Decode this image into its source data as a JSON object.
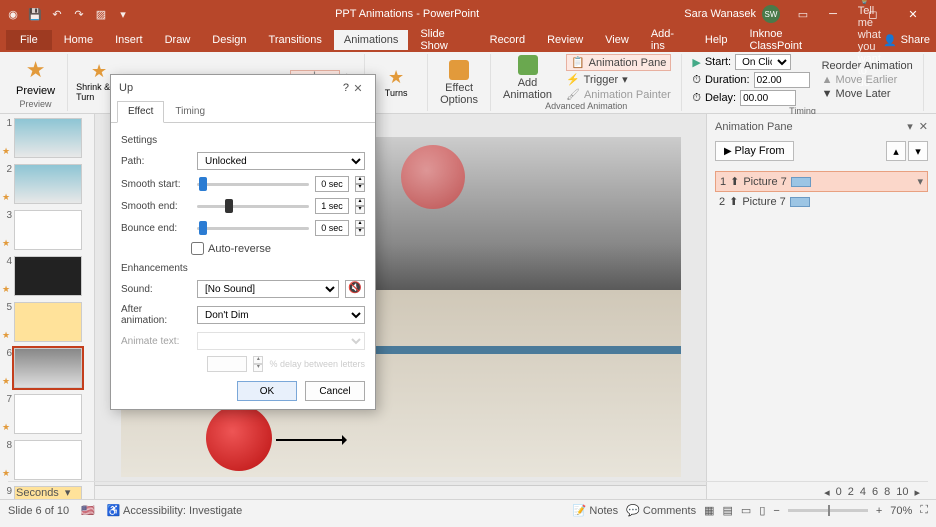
{
  "titlebar": {
    "doc_title": "PPT Animations - PowerPoint",
    "user_name": "Sara Wanasek",
    "user_initials": "SW"
  },
  "ribbon_tabs": {
    "file": "File",
    "home": "Home",
    "insert": "Insert",
    "draw": "Draw",
    "design": "Design",
    "transitions": "Transitions",
    "animations": "Animations",
    "slideshow": "Slide Show",
    "record": "Record",
    "review": "Review",
    "view": "View",
    "addins": "Add-ins",
    "help": "Help",
    "inknoe": "Inknoe ClassPoint",
    "tellme": "Tell me what you want to do",
    "share": "Share"
  },
  "ribbon": {
    "preview": "Preview",
    "preview_group": "Preview",
    "gallery": {
      "shrink_turn": "Shrink & Turn",
      "turns": "Turns"
    },
    "effect_options": "Effect\nOptions",
    "add_animation": "Add\nAnimation",
    "anim_pane_btn": "Animation Pane",
    "trigger": "Trigger",
    "anim_painter": "Animation Painter",
    "adv_group": "Advanced Animation",
    "start_label": "Start:",
    "start_value": "On Click",
    "duration_label": "Duration:",
    "duration_value": "02.00",
    "delay_label": "Delay:",
    "delay_value": "00.00",
    "timing_group": "Timing",
    "reorder": "Reorder Animation",
    "move_earlier": "Move Earlier",
    "move_later": "Move Later"
  },
  "dialog": {
    "title": "Up",
    "tab_effect": "Effect",
    "tab_timing": "Timing",
    "sec_settings": "Settings",
    "path_label": "Path:",
    "path_value": "Unlocked",
    "smooth_start_label": "Smooth start:",
    "smooth_start_value": "0 sec",
    "smooth_end_label": "Smooth end:",
    "smooth_end_value": "1 sec",
    "bounce_end_label": "Bounce end:",
    "bounce_end_value": "0 sec",
    "auto_reverse": "Auto-reverse",
    "sec_enhance": "Enhancements",
    "sound_label": "Sound:",
    "sound_value": "[No Sound]",
    "after_label": "After animation:",
    "after_value": "Don't Dim",
    "animtext_label": "Animate text:",
    "delay_letters": "% delay between letters",
    "ok": "OK",
    "cancel": "Cancel"
  },
  "anim_pane": {
    "title": "Animation Pane",
    "play_from": "Play From",
    "item1_num": "1",
    "item1_name": "Picture 7",
    "item2_num": "2",
    "item2_name": "Picture 7",
    "seconds": "Seconds",
    "ticks": [
      "0",
      "2",
      "4",
      "6",
      "8",
      "10"
    ]
  },
  "status": {
    "slide_of": "Slide 6 of 10",
    "accessibility": "Accessibility: Investigate",
    "notes": "Notes",
    "comments": "Comments",
    "zoom": "70%"
  },
  "thumbs": [
    "1",
    "2",
    "3",
    "4",
    "5",
    "6",
    "7",
    "8",
    "9"
  ]
}
